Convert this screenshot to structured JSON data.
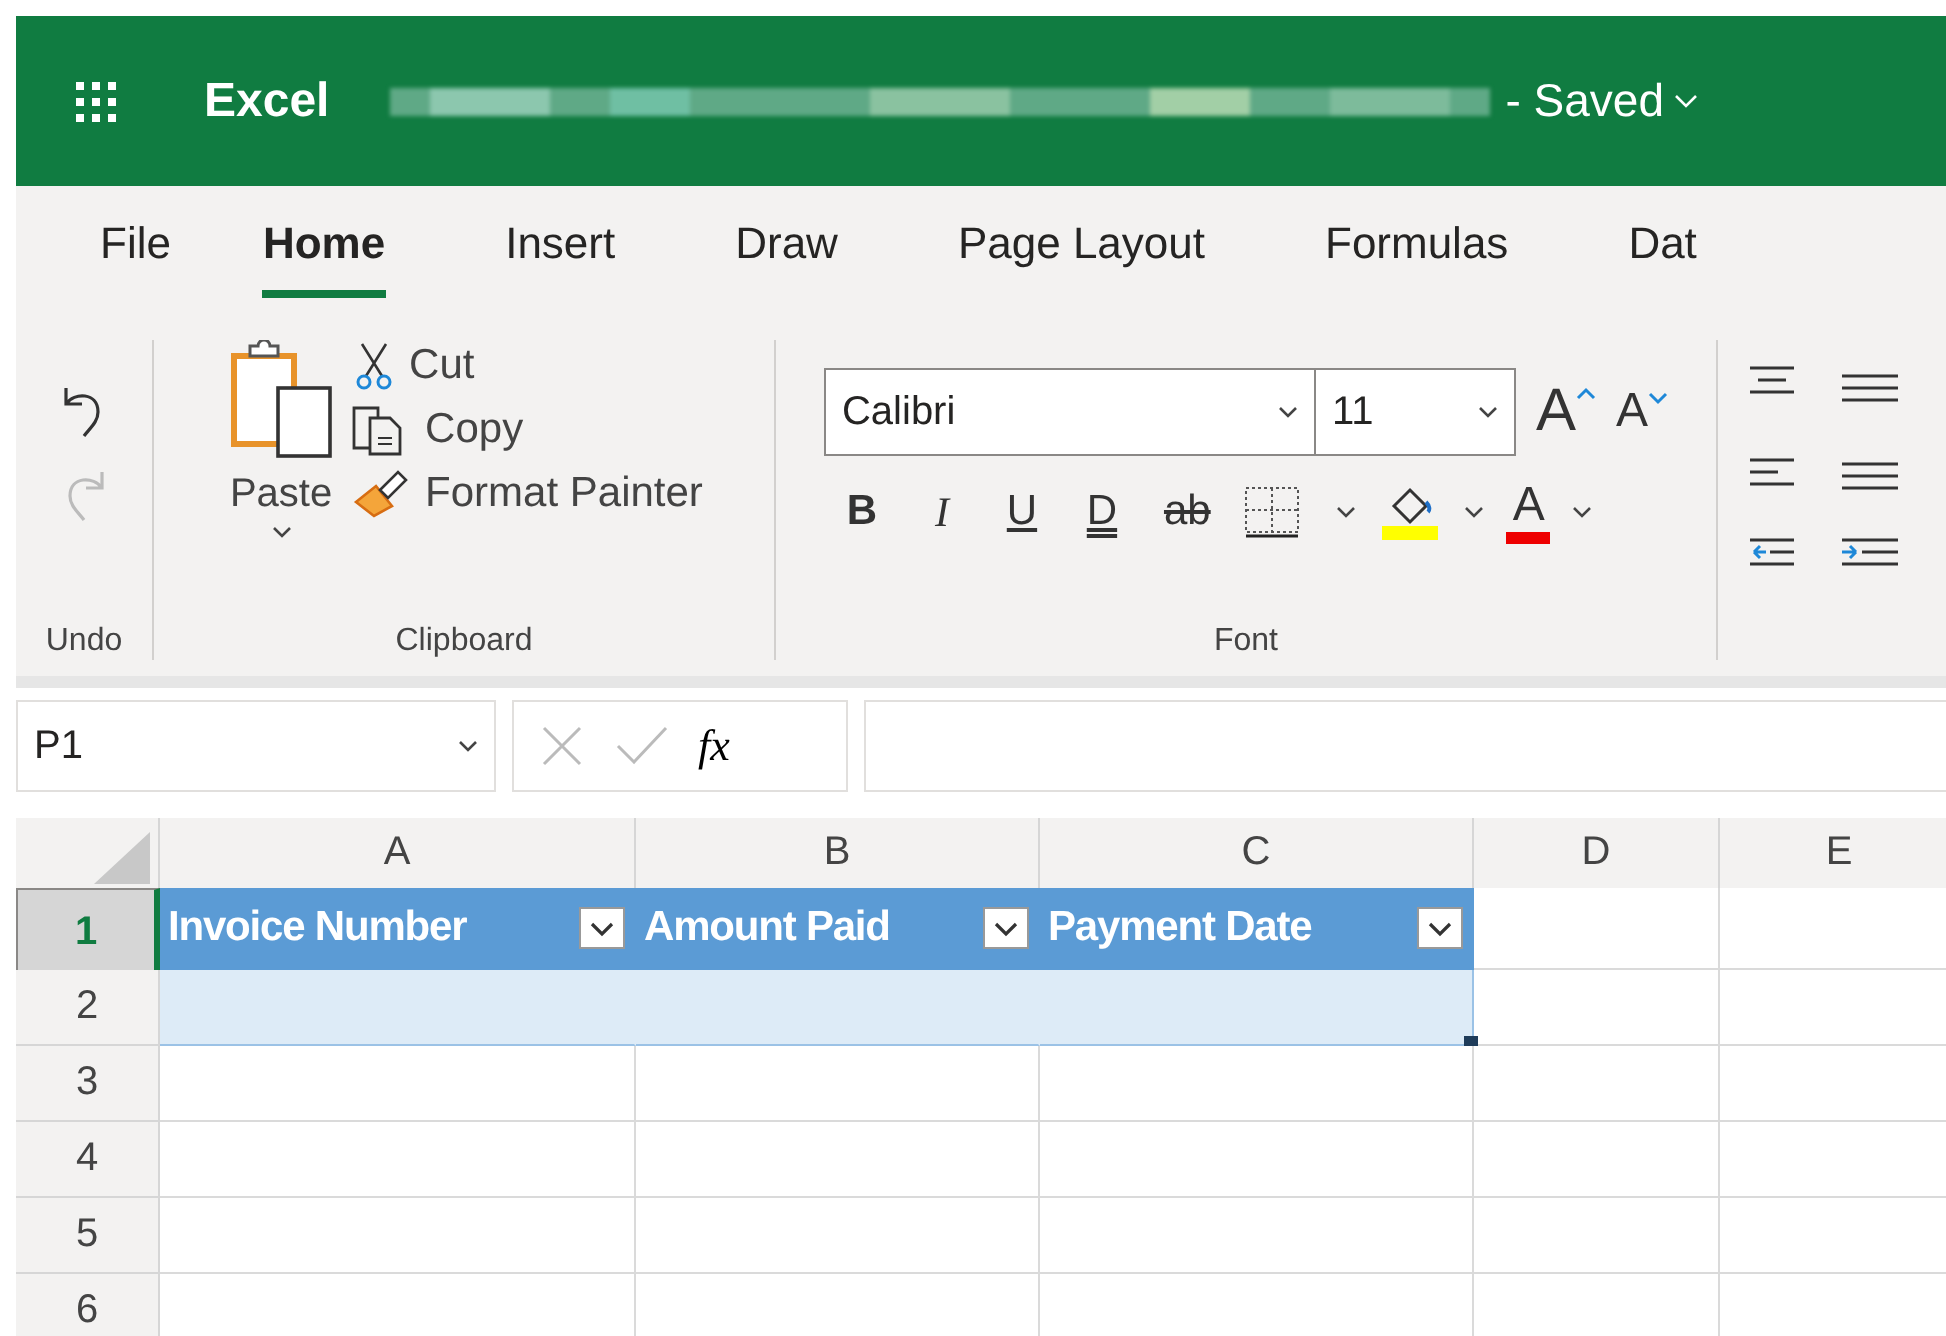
{
  "app_bar": {
    "app_name": "Excel",
    "status": "- Saved"
  },
  "ribbon_tabs": [
    {
      "label": "File",
      "selected": false
    },
    {
      "label": "Home",
      "selected": true
    },
    {
      "label": "Insert",
      "selected": false
    },
    {
      "label": "Draw",
      "selected": false
    },
    {
      "label": "Page Layout",
      "selected": false
    },
    {
      "label": "Formulas",
      "selected": false
    },
    {
      "label": "Dat",
      "selected": false
    }
  ],
  "ribbon": {
    "undo_group": {
      "label": "Undo",
      "redo_disabled": true
    },
    "clipboard_group": {
      "label": "Clipboard",
      "paste": "Paste",
      "cut": "Cut",
      "copy": "Copy",
      "format_painter": "Format Painter"
    },
    "font_group": {
      "label": "Font",
      "font_name": "Calibri",
      "font_size": "11",
      "grow_font": "A",
      "shrink_font": "A",
      "font_color": "A",
      "format_buttons": [
        {
          "kind": "bold",
          "label": "B"
        },
        {
          "kind": "italic",
          "label": "I"
        },
        {
          "kind": "underline",
          "label": "U"
        },
        {
          "kind": "double-underline",
          "label": "D"
        },
        {
          "kind": "strikethrough",
          "label": "ab"
        }
      ]
    }
  },
  "formula_bar": {
    "name_box": "P1",
    "function_label": "fx"
  },
  "sheet": {
    "columns": [
      "A",
      "B",
      "C",
      "D",
      "E"
    ],
    "rows": [
      {
        "number": "1",
        "selected": true,
        "kind": "table-header",
        "cells": [
          "Invoice Number",
          "Amount Paid",
          "Payment Date"
        ]
      },
      {
        "number": "2",
        "selected": false,
        "kind": "table-row"
      },
      {
        "number": "3",
        "selected": false,
        "kind": "plain"
      },
      {
        "number": "4",
        "selected": false,
        "kind": "plain"
      },
      {
        "number": "5",
        "selected": false,
        "kind": "plain"
      },
      {
        "number": "6",
        "selected": false,
        "kind": "plain"
      }
    ]
  }
}
